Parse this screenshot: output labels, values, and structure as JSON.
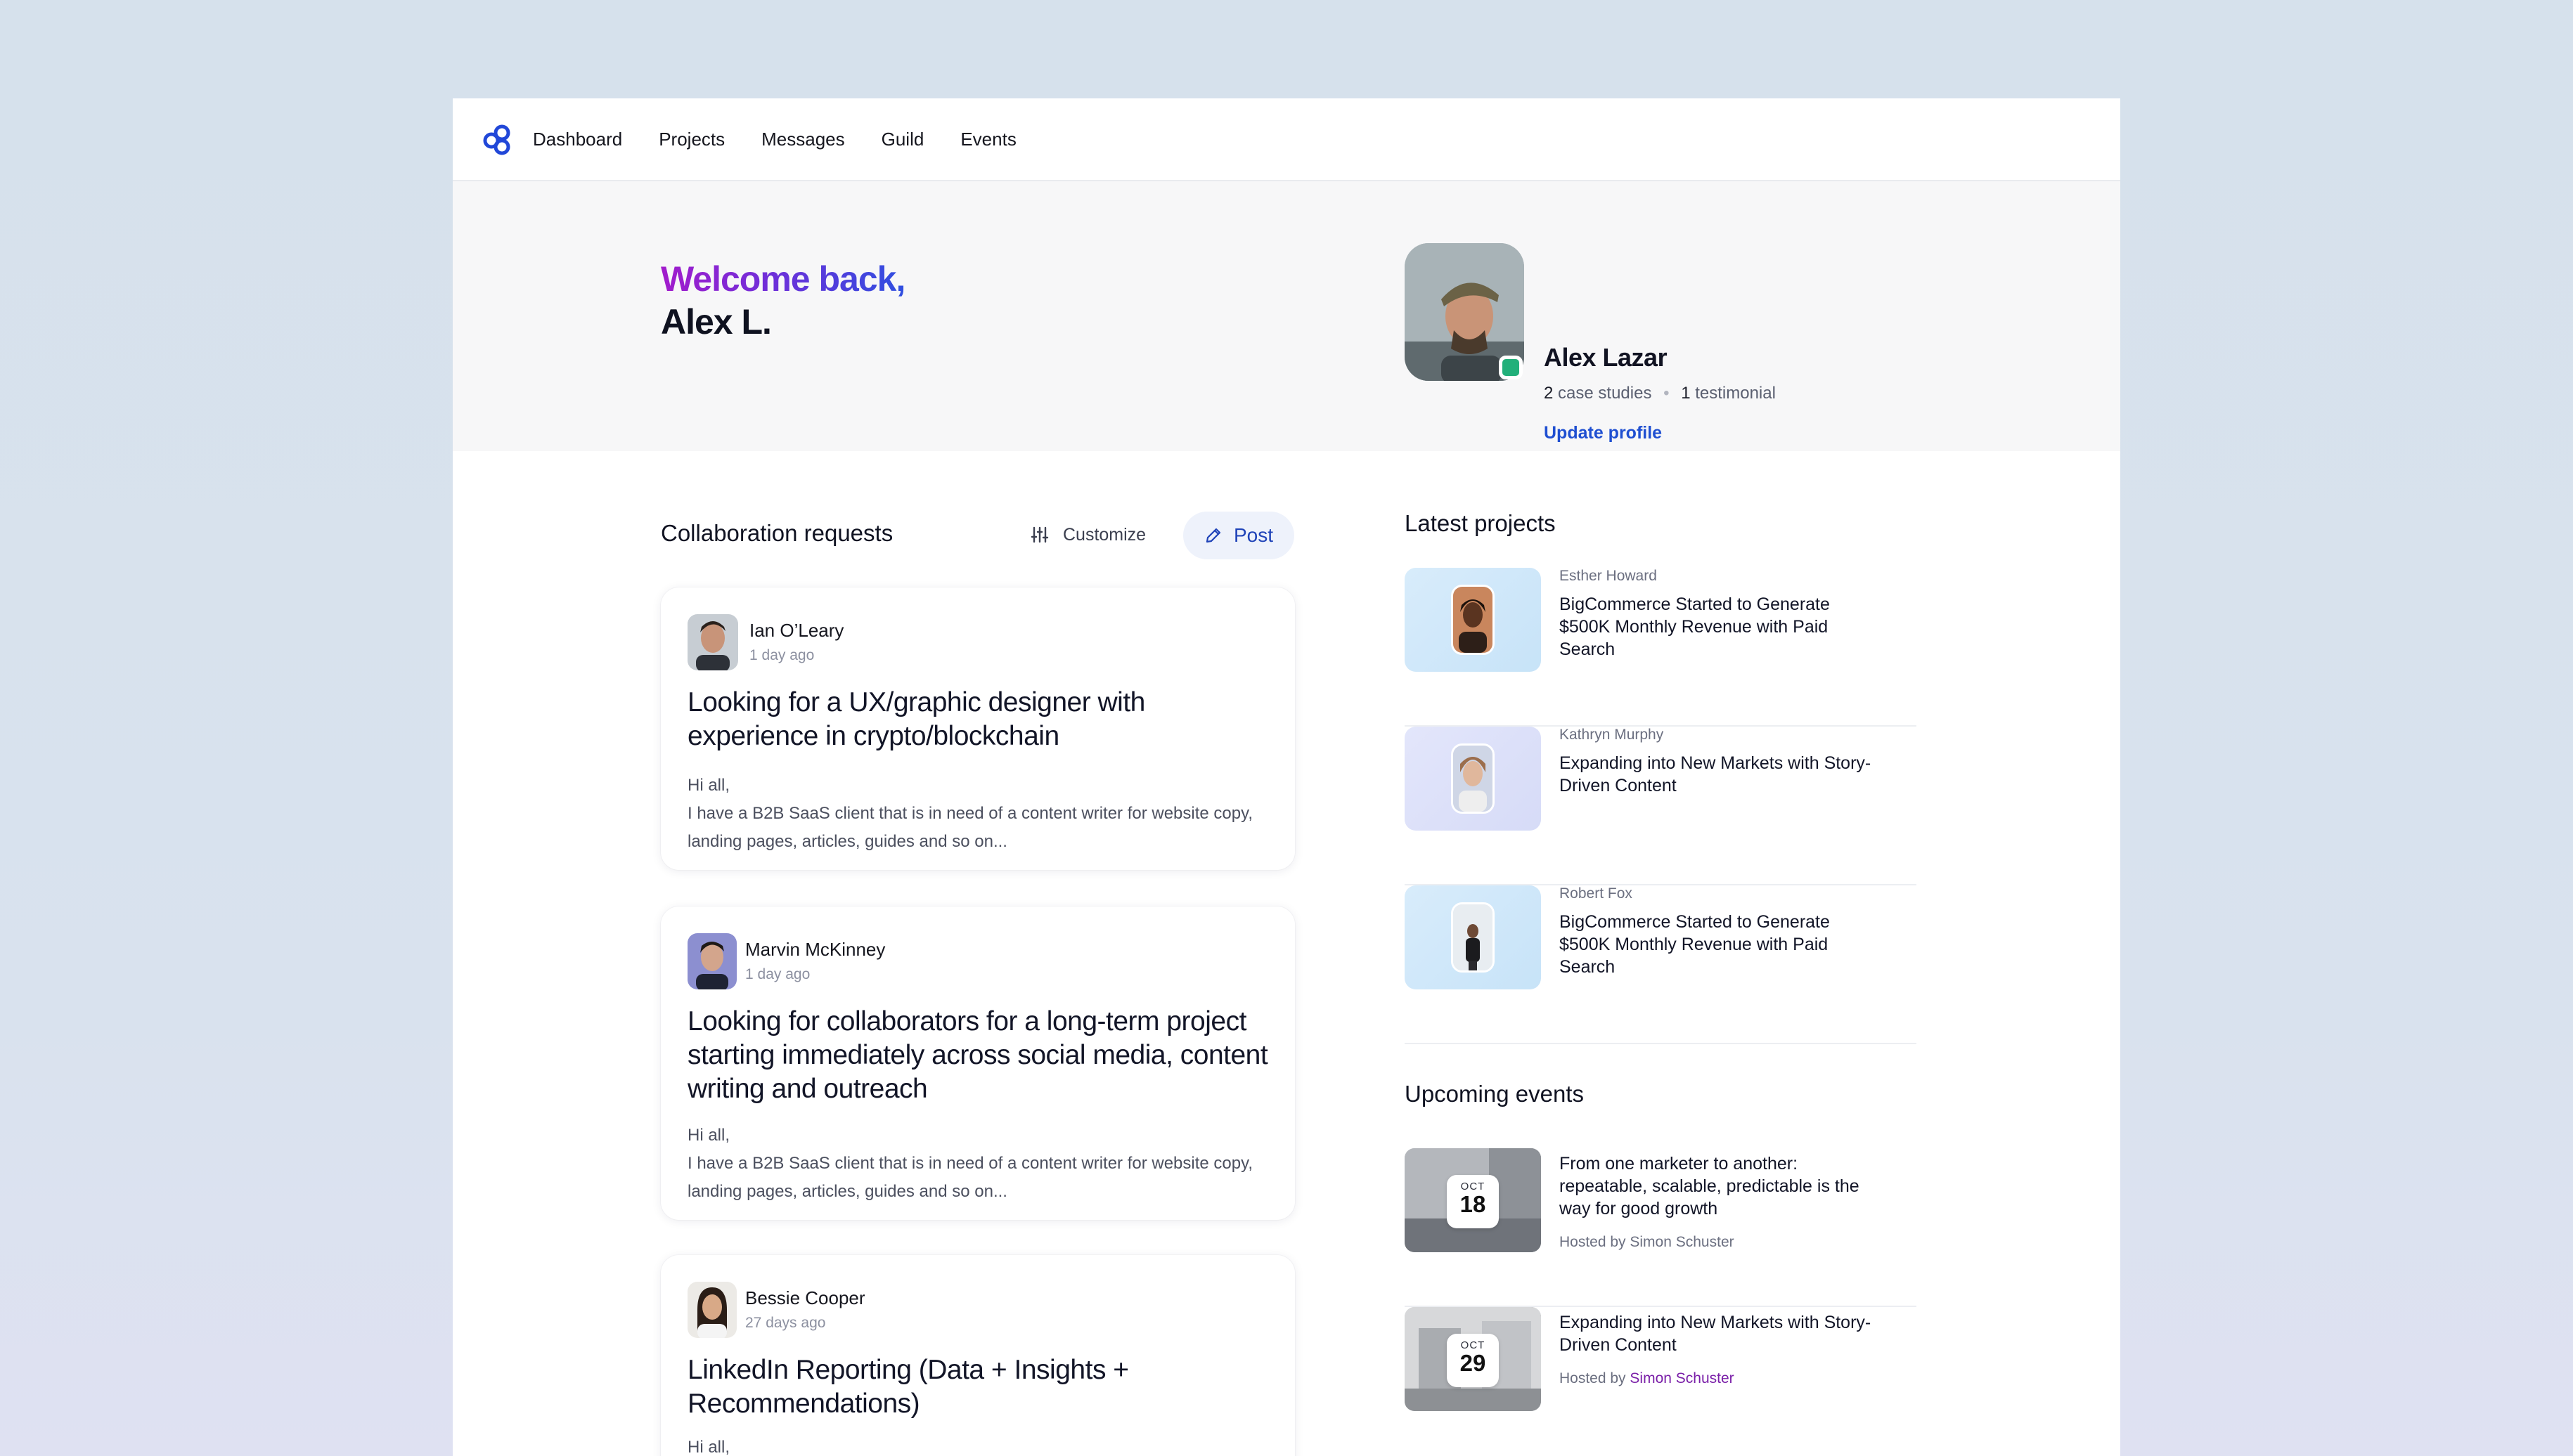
{
  "nav": {
    "items": [
      "Dashboard",
      "Projects",
      "Messages",
      "Guild",
      "Events"
    ]
  },
  "hero": {
    "welcome_line1": "Welcome back,",
    "welcome_line2": "Alex L.",
    "profile": {
      "name": "Alex Lazar",
      "case_studies_count": "2",
      "case_studies_label": "case studies",
      "testimonial_count": "1",
      "testimonial_label": "testimonial",
      "update_link": "Update profile"
    }
  },
  "collab": {
    "title": "Collaboration requests",
    "customize_label": "Customize",
    "post_label": "Post",
    "requests": [
      {
        "name": "Ian O’Leary",
        "time": "1 day ago",
        "title": "Looking for a UX/graphic designer with experience in crypto/blockchain",
        "greeting": "Hi all,",
        "body": "I have a B2B SaaS client that is in need of a content writer for website copy, landing pages, articles, guides and so on..."
      },
      {
        "name": "Marvin McKinney",
        "time": "1 day ago",
        "title": "Looking for collaborators for a long-term project starting immediately across social media, content writing and outreach",
        "greeting": "Hi all,",
        "body": "I have a B2B SaaS client that is in need of a content writer for website copy, landing pages, articles, guides and so on..."
      },
      {
        "name": "Bessie Cooper",
        "time": "27 days ago",
        "title": "LinkedIn Reporting (Data + Insights + Recommendations)",
        "greeting": "Hi all,"
      }
    ]
  },
  "latest_projects": {
    "title": "Latest projects",
    "items": [
      {
        "author": "Esther Howard",
        "title": "BigCommerce Started to Generate $500K Monthly Revenue with Paid Search"
      },
      {
        "author": "Kathryn Murphy",
        "title": "Expanding into New Markets with Story-Driven Content"
      },
      {
        "author": "Robert Fox",
        "title": "BigCommerce Started to Generate $500K Monthly Revenue with Paid Search"
      }
    ]
  },
  "upcoming_events": {
    "title": "Upcoming events",
    "items": [
      {
        "month": "OCT",
        "day": "18",
        "title": "From one marketer to another: repeatable, scalable, predictable is the way for good growth",
        "host_prefix": "Hosted by Simon Schuster",
        "host_link": ""
      },
      {
        "month": "OCT",
        "day": "29",
        "title": "Expanding into New Markets with Story-Driven Content",
        "host_prefix": "Hosted by",
        "host_link": "Simon Schuster"
      }
    ]
  },
  "colors": {
    "accent": "#1f4fd1",
    "online": "#22b07a",
    "welcome_gradient_start": "#a21ccc",
    "welcome_gradient_end": "#2f4fe0",
    "host_link": "#7a1fa8"
  },
  "icons": {
    "logo": "infinity-logo-icon",
    "customize": "sliders-icon",
    "post": "pencil-icon"
  }
}
